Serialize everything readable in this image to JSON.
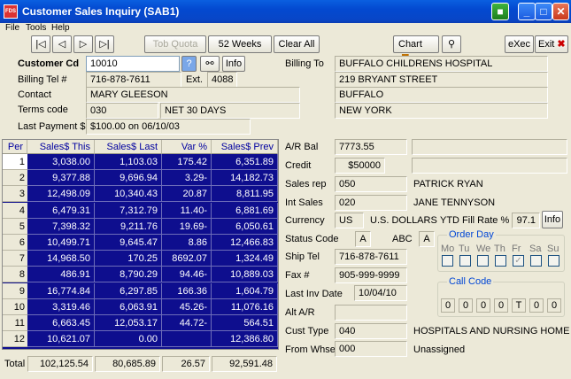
{
  "window": {
    "title": "Customer Sales Inquiry  (SAB1)",
    "app_icon": "FDS"
  },
  "menu": [
    "File",
    "Tools",
    "Help"
  ],
  "toolbar": {
    "tob_quota": "Tob Quota",
    "weeks52": "52 Weeks",
    "clear_all": "Clear All",
    "chart": "Chart",
    "exec": "eXec",
    "exit": "Exit"
  },
  "customer": {
    "cd_label": "Customer Cd",
    "cd_value": "10010",
    "help_btn": "?",
    "info_btn": "Info",
    "billing_tel_label": "Billing Tel #",
    "billing_tel": "716-878-7611",
    "ext_label": "Ext.",
    "ext": "4088",
    "contact_label": "Contact",
    "contact": "MARY GLEESON",
    "terms_label": "Terms code",
    "terms_code": "030",
    "terms_desc": "NET 30 DAYS",
    "last_payment_label": "Last Payment $",
    "last_payment": "$100.00 on 06/10/03"
  },
  "billing_to": {
    "label": "Billing To",
    "lines": [
      "BUFFALO CHILDRENS HOSPITAL",
      "219 BRYANT STREET",
      "BUFFALO",
      "NEW YORK"
    ]
  },
  "grid": {
    "headers": [
      "Per",
      "Sales$ This Yr",
      "Sales$ Last Yr",
      "Var %",
      "Sales$ Prev Yr"
    ],
    "rows": [
      [
        "1",
        "3,038.00",
        "1,103.03",
        "175.42",
        "6,351.89"
      ],
      [
        "2",
        "9,377.88",
        "9,696.94",
        "3.29-",
        "14,182.73"
      ],
      [
        "3",
        "12,498.09",
        "10,340.43",
        "20.87",
        "8,811.95"
      ],
      [
        "4",
        "6,479.31",
        "7,312.79",
        "11.40-",
        "6,881.69"
      ],
      [
        "5",
        "7,398.32",
        "9,211.76",
        "19.69-",
        "6,050.61"
      ],
      [
        "6",
        "10,499.71",
        "9,645.47",
        "8.86",
        "12,466.83"
      ],
      [
        "7",
        "14,968.50",
        "170.25",
        "8692.07",
        "1,324.49"
      ],
      [
        "8",
        "486.91",
        "8,790.29",
        "94.46-",
        "10,889.03"
      ],
      [
        "9",
        "16,774.84",
        "6,297.85",
        "166.36",
        "1,604.79"
      ],
      [
        "10",
        "3,319.46",
        "6,063.91",
        "45.26-",
        "11,076.16"
      ],
      [
        "11",
        "6,663.45",
        "12,053.17",
        "44.72-",
        "564.51"
      ],
      [
        "12",
        "10,621.07",
        "0.00",
        "",
        "12,386.80"
      ]
    ],
    "total_label": "Total",
    "totals": [
      "102,125.54",
      "80,685.89",
      "26.57",
      "92,591.48"
    ]
  },
  "details": {
    "ar_bal_label": "A/R Bal",
    "ar_bal": "7773.55",
    "credit_label": "Credit",
    "credit": "$50000",
    "sales_rep_label": "Sales rep",
    "sales_rep_code": "050",
    "sales_rep_name": "PATRICK RYAN",
    "int_sales_label": "Int Sales",
    "int_sales_code": "020",
    "int_sales_name": "JANE TENNYSON",
    "currency_label": "Currency",
    "currency_code": "US",
    "currency_name": "U.S. DOLLARS",
    "ytd_fill_label": "YTD Fill Rate %",
    "ytd_fill": "97.1",
    "ytd_info": "Info",
    "status_label": "Status Code",
    "status": "A",
    "abc_label": "ABC",
    "abc": "A",
    "ship_tel_label": "Ship Tel",
    "ship_tel": "716-878-7611",
    "fax_label": "Fax #",
    "fax": "905-999-9999",
    "last_inv_label": "Last Inv Date",
    "last_inv": "10/04/10",
    "alt_ar_label": "Alt A/R",
    "alt_ar": "",
    "cust_type_label": "Cust Type",
    "cust_type_code": "040",
    "cust_type_name": "HOSPITALS AND NURSING HOMES",
    "from_whse_label": "From Whse",
    "from_whse": "000",
    "from_whse_name": "Unassigned"
  },
  "order_day": {
    "title": "Order Day",
    "days": [
      "Mo",
      "Tu",
      "We",
      "Th",
      "Fr",
      "Sa",
      "Su"
    ],
    "checked": [
      false,
      false,
      false,
      false,
      true,
      false,
      false
    ]
  },
  "call_code": {
    "title": "Call Code",
    "values": [
      "0",
      "0",
      "0",
      "0",
      "T",
      "0",
      "0"
    ]
  }
}
